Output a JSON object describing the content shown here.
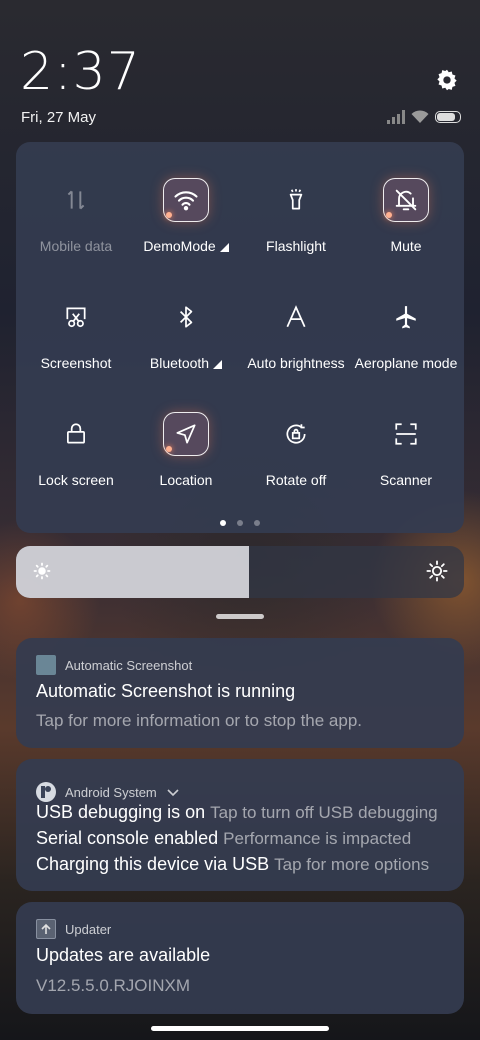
{
  "status": {
    "time": "2:37",
    "date": "Fri, 27 May"
  },
  "quick_settings": {
    "tiles": [
      {
        "label": "Mobile data",
        "icon": "mobile-data-icon",
        "active": false,
        "disabled": true
      },
      {
        "label": "DemoMode",
        "icon": "wifi-icon",
        "active": true,
        "has_menu": true
      },
      {
        "label": "Flashlight",
        "icon": "flashlight-icon",
        "active": false
      },
      {
        "label": "Mute",
        "icon": "bell-off-icon",
        "active": true
      },
      {
        "label": "Screenshot",
        "icon": "screenshot-icon",
        "active": false
      },
      {
        "label": "Bluetooth",
        "icon": "bluetooth-icon",
        "active": false,
        "has_menu": true
      },
      {
        "label": "Auto brightness",
        "icon": "auto-brightness-icon",
        "active": false
      },
      {
        "label": "Aeroplane mode",
        "icon": "airplane-icon",
        "active": false
      },
      {
        "label": "Lock screen",
        "icon": "lock-icon",
        "active": false
      },
      {
        "label": "Location",
        "icon": "location-icon",
        "active": true
      },
      {
        "label": "Rotate off",
        "icon": "rotate-lock-icon",
        "active": false
      },
      {
        "label": "Scanner",
        "icon": "scanner-icon",
        "active": false
      }
    ],
    "page_count": 3,
    "current_page": 1
  },
  "brightness": {
    "level": 0.52
  },
  "notifications": [
    {
      "app": "Automatic Screenshot",
      "title": "Automatic Screenshot is running",
      "text": "Tap for more information or to stop the app."
    },
    {
      "app": "Android System",
      "rows": [
        {
          "title": "USB debugging is on",
          "text": "Tap to turn off USB debugging"
        },
        {
          "title": "Serial console enabled",
          "text": "Performance is impacted"
        },
        {
          "title": "Charging this device via USB",
          "text": "Tap for more options"
        }
      ]
    },
    {
      "app": "Updater",
      "title": "Updates are available",
      "text": "V12.5.5.0.RJOINXM"
    }
  ],
  "colors": {
    "panel": "#343c50",
    "accent_glow": "#ff8a5a"
  }
}
